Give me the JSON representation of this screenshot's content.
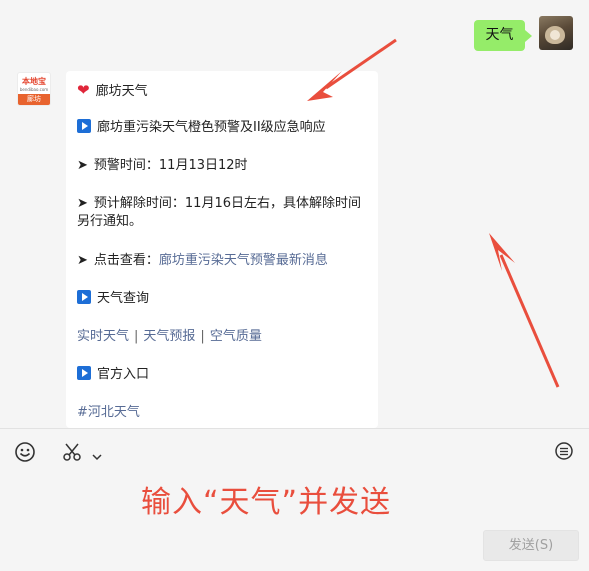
{
  "chat": {
    "outgoing": {
      "text": "天气"
    },
    "bot": {
      "logo_top": "本地宝",
      "logo_mid": "bendibao.com",
      "logo_bottom": "廊坊"
    },
    "incoming": {
      "title": "廊坊天气",
      "alert_headline": "廊坊重污染天气橙色预警及II级应急响应",
      "alert_time": "预警时间：11月13日12时",
      "lift_time": "预计解除时间：11月16日左右，具体解除时间另行通知。",
      "check_prefix": "点击查看：",
      "check_link": "廊坊重污染天气预警最新消息",
      "query_heading": "天气查询",
      "links": [
        "实时天气",
        "天气预报",
        "空气质量"
      ],
      "link_separator": "|",
      "official_heading": "官方入口",
      "hashtag": "#河北天气"
    }
  },
  "toolbar": {
    "emoji_icon": "smile-icon",
    "scissors_icon": "scissors-icon",
    "history_icon": "chat-history-icon"
  },
  "hint": "输入“天气”并发送",
  "send_button": "发送(S)",
  "colors": {
    "bubble_out": "#95ec69",
    "link": "#576b95",
    "annotation": "#e94e3d",
    "play_icon": "#1d6ed6"
  }
}
